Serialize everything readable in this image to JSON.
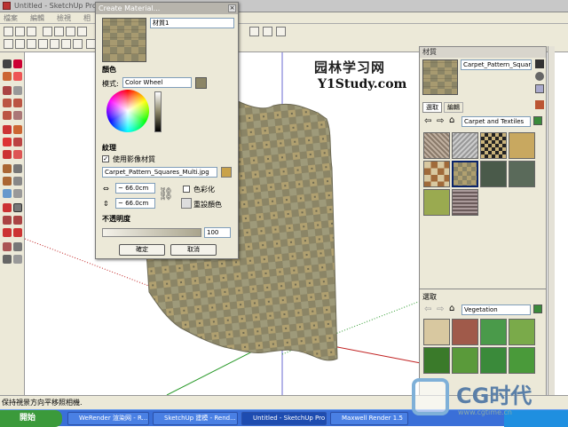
{
  "app": {
    "title": "Untitled - SketchUp Pro",
    "menus": [
      "檔案",
      "編輯",
      "檢視",
      "相"
    ]
  },
  "logo": {
    "cn": "园林学习网",
    "en": "Y1Study.com"
  },
  "dialog": {
    "title": "Create Material...",
    "close": "×",
    "name_value": "材質1",
    "color_heading": "顏色",
    "mode_label": "模式:",
    "mode_value": "Color Wheel",
    "texture_heading": "紋理",
    "use_texture_label": "使用影像材質",
    "texture_file": "Carpet_Pattern_Squares_Multi.jpg",
    "width_value": "~ 66.0cm",
    "height_value": "~ 66.0cm",
    "colorize_label": "色彩化",
    "reset_label": "重設顏色",
    "opacity_heading": "不透明度",
    "opacity_value": "100",
    "ok_label": "確定",
    "cancel_label": "取消"
  },
  "panel": {
    "title": "材質",
    "material_name": "Carpet_Pattern_Squares",
    "tabs": [
      "選取",
      "編輯"
    ],
    "library": "Carpet and Textiles",
    "lower_title": "選取",
    "lower_library": "Vegetation"
  },
  "status": {
    "text": "保持視景方向平移照相機."
  },
  "taskbar": {
    "start": "開始",
    "tasks": [
      "WeRender 渲染网 - R...",
      "SketchUp 建模 - Rend...",
      "Untitled - SketchUp Pro",
      "Maxwell Render 1.5"
    ]
  },
  "watermark": {
    "cg": "CG时代",
    "url": "www.cgtime.cn"
  },
  "colors": {
    "selected_color": "#8b8566",
    "taskbar": "#3a6fd8",
    "accent_blue": "#0a246a"
  }
}
